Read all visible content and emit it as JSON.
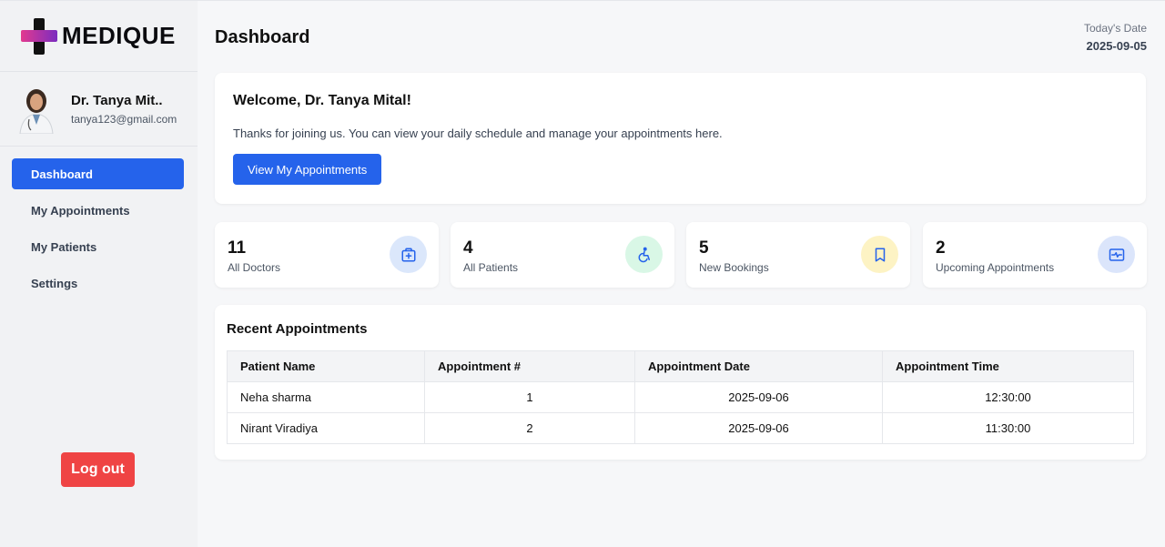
{
  "brand": {
    "name": "MEDIQUE",
    "logo_icon": "medical-cross-icon",
    "gradient": [
      "#e23a8f",
      "#7b2cbf"
    ]
  },
  "profile": {
    "name": "Dr. Tanya Mit..",
    "email": "tanya123@gmail.com"
  },
  "nav": {
    "items": [
      {
        "label": "Dashboard",
        "active": true
      },
      {
        "label": "My Appointments",
        "active": false
      },
      {
        "label": "My Patients",
        "active": false
      },
      {
        "label": "Settings",
        "active": false
      }
    ]
  },
  "logout_label": "Log out",
  "header": {
    "title": "Dashboard",
    "date_label": "Today's Date",
    "date_value": "2025-09-05"
  },
  "welcome": {
    "title": "Welcome, Dr. Tanya Mital!",
    "text": "Thanks for joining us. You can view your daily schedule and manage your appointments here.",
    "button_label": "View My Appointments"
  },
  "stats": [
    {
      "value": "11",
      "label": "All Doctors",
      "icon": "medical-kit-icon",
      "icon_bg": "#dbe7fb",
      "icon_color": "#2563eb"
    },
    {
      "value": "4",
      "label": "All Patients",
      "icon": "wheelchair-icon",
      "icon_bg": "#d9f7e6",
      "icon_color": "#2563eb"
    },
    {
      "value": "5",
      "label": "New Bookings",
      "icon": "bookmark-icon",
      "icon_bg": "#fdf3c4",
      "icon_color": "#2563eb"
    },
    {
      "value": "2",
      "label": "Upcoming Appointments",
      "icon": "pulse-monitor-icon",
      "icon_bg": "#dbe5fb",
      "icon_color": "#2563eb"
    }
  ],
  "recent": {
    "title": "Recent Appointments",
    "columns": [
      "Patient Name",
      "Appointment #",
      "Appointment Date",
      "Appointment Time"
    ],
    "rows": [
      [
        "Neha sharma",
        "1",
        "2025-09-06",
        "12:30:00"
      ],
      [
        "Nirant Viradiya",
        "2",
        "2025-09-06",
        "11:30:00"
      ]
    ]
  },
  "colors": {
    "accent": "#2563eb",
    "danger": "#ef4444"
  }
}
